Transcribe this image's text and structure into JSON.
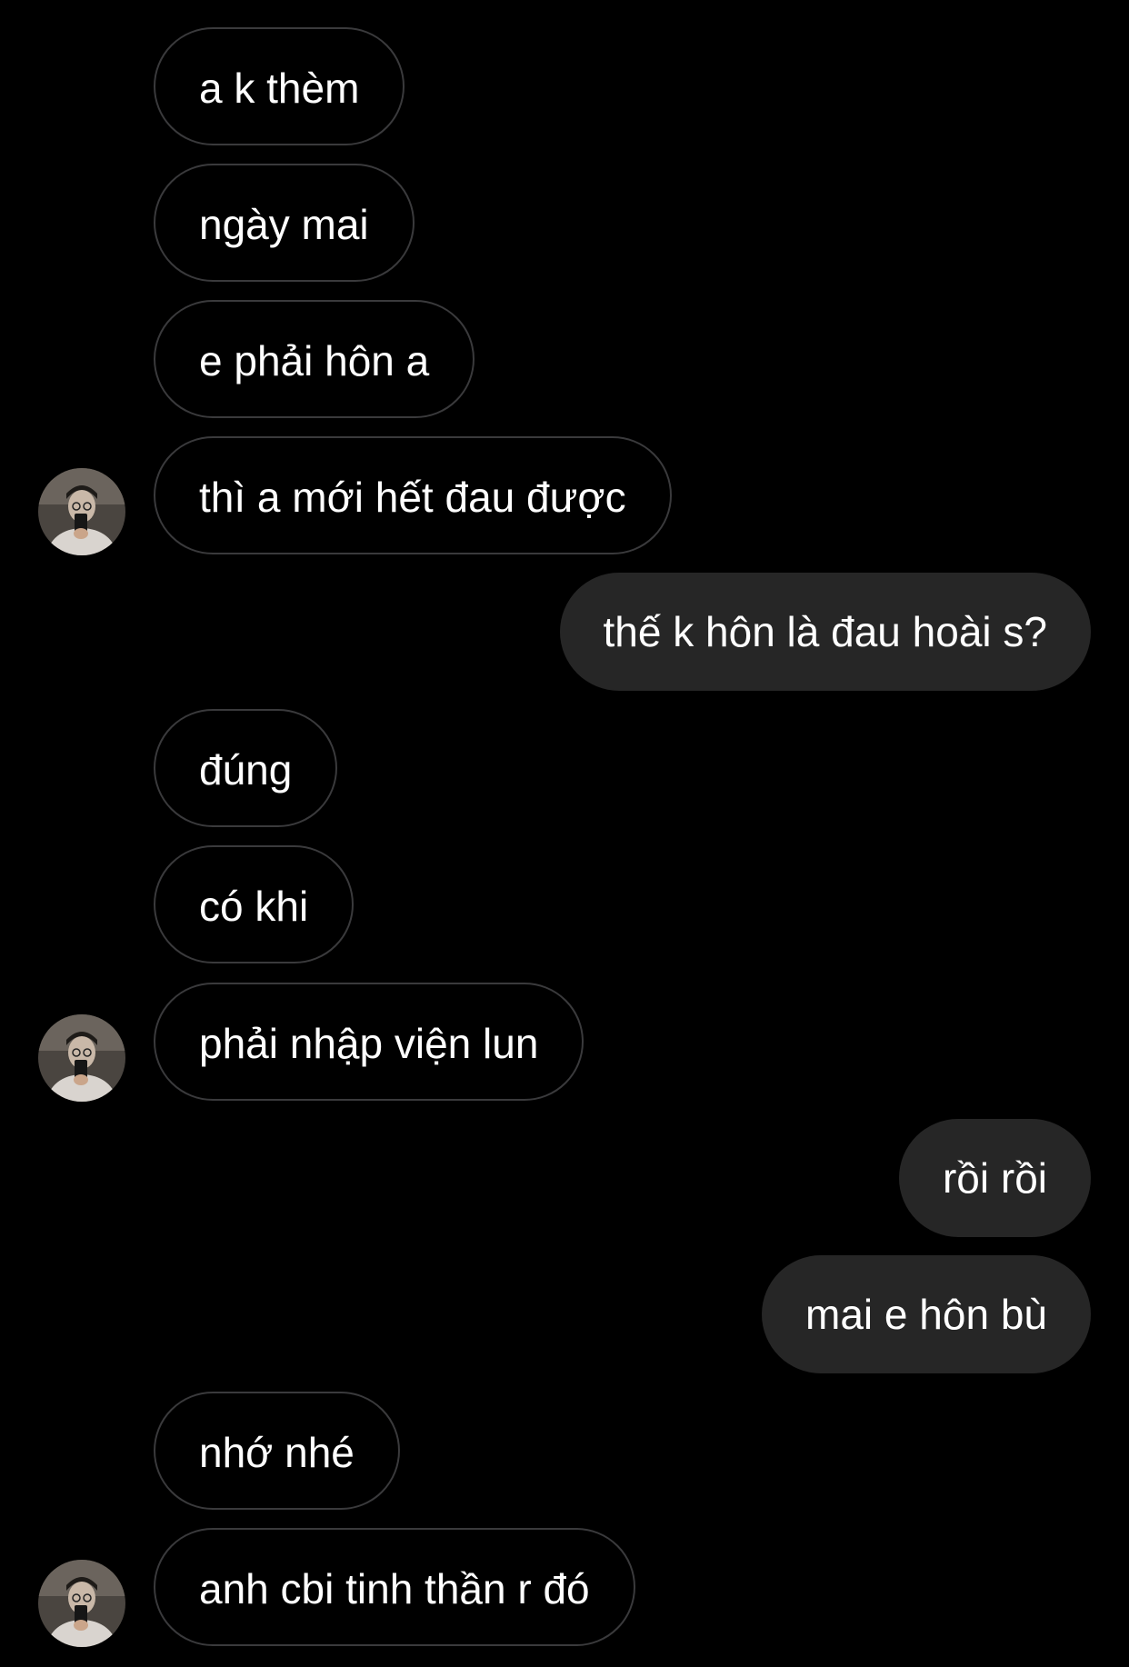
{
  "conversation": {
    "messages": [
      {
        "text": "a k thèm"
      },
      {
        "text": "ngày mai"
      },
      {
        "text": "e phải hôn a"
      },
      {
        "text": "thì a mới hết đau được"
      },
      {
        "text": "thế k hôn là đau hoài s?"
      },
      {
        "text": "đúng"
      },
      {
        "text": "có khi"
      },
      {
        "text": "phải nhập viện lun"
      },
      {
        "text": "rồi rồi"
      },
      {
        "text": "mai e hôn bù"
      },
      {
        "text": "nhớ nhé"
      },
      {
        "text": "anh cbi tinh thần r đó"
      }
    ]
  },
  "colors": {
    "background": "#000000",
    "incoming_border": "#3a3a3c",
    "outgoing_fill": "#262626",
    "text": "#ffffff"
  },
  "icons": {
    "avatar": "sender-avatar-photo"
  }
}
